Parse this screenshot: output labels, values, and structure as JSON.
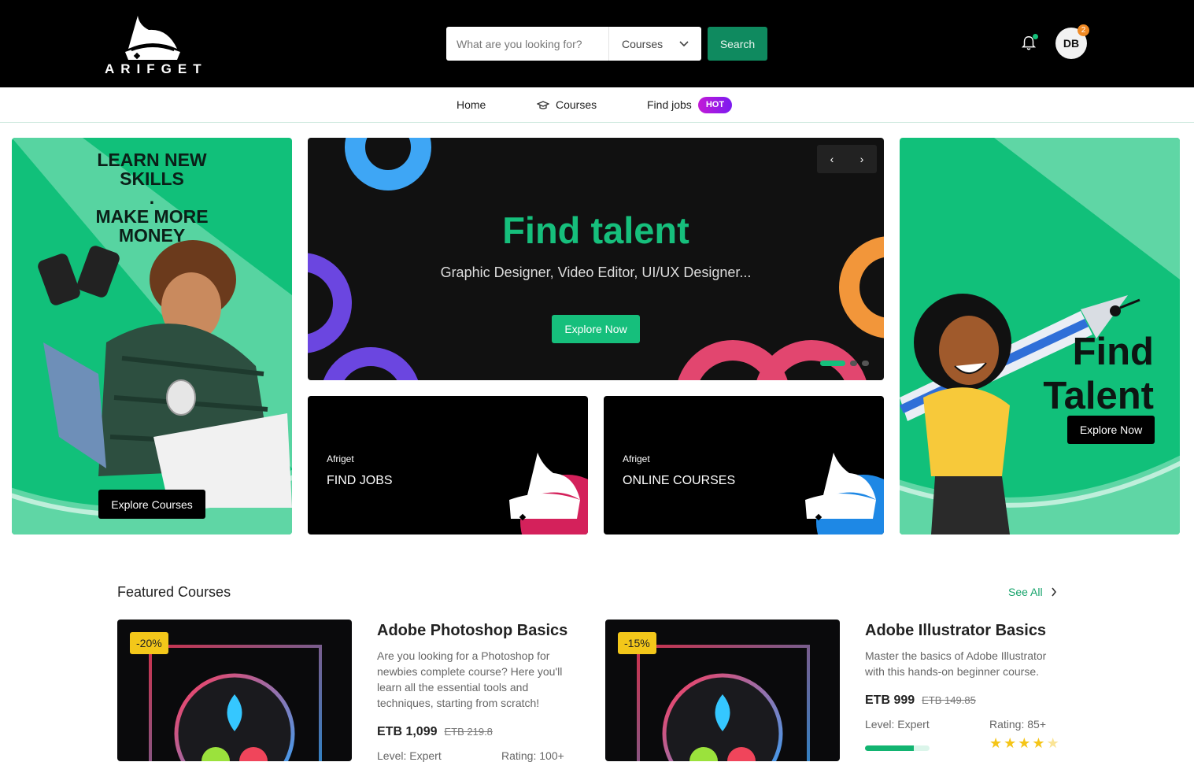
{
  "header": {
    "logo_text": "ARIFGET",
    "search_placeholder": "What are you looking for?",
    "search_category": "Courses",
    "search_button": "Search",
    "avatar_initials": "DB",
    "notification_count": "2",
    "icons": {
      "bell": "bell-icon",
      "chevron": "chevron-down-icon"
    }
  },
  "nav": {
    "items": [
      {
        "label": "Home"
      },
      {
        "label": "Courses",
        "icon": "graduation-cap-icon"
      },
      {
        "label": "Find jobs",
        "badge": "HOT"
      }
    ]
  },
  "promo_left": {
    "title": "LEARN NEW\nSKILLS\n.\nMAKE MORE\nMONEY",
    "button": "Explore Courses"
  },
  "slider": {
    "title": "Find talent",
    "subtitle": "Graphic Designer, Video Editor, UI/UX Designer...",
    "button": "Explore Now",
    "prev": "‹",
    "next": "›",
    "slides": 3,
    "active_slide": 1
  },
  "mini_cards": [
    {
      "brand": "Afriget",
      "title": "FIND JOBS",
      "accent": "#d4215b"
    },
    {
      "brand": "Afriget",
      "title": "ONLINE COURSES",
      "accent": "#1e88e5"
    }
  ],
  "promo_right": {
    "title": "Find\nTalent",
    "button": "Explore Now"
  },
  "featured": {
    "title": "Featured Courses",
    "see_all": "See All",
    "courses": [
      {
        "discount": "-20%",
        "title": "Adobe Photoshop Basics",
        "description": "Are you looking for a Photoshop for newbies complete course? Here you'll learn all the essential tools and techniques, starting from scratch!",
        "price": "ETB 1,099",
        "old_price": "ETB 219.8",
        "level": "Level: Expert",
        "rating": "Rating: 100+"
      },
      {
        "discount": "-15%",
        "title": "Adobe Illustrator Basics",
        "description": "Master the basics of Adobe Illustrator with this hands-on beginner course.",
        "price": "ETB 999",
        "old_price": "ETB 149.85",
        "level": "Level: Expert",
        "level_progress": 0.75,
        "rating": "Rating: 85+",
        "stars": 4.5
      }
    ]
  },
  "colors": {
    "brand_green": "#11c07a",
    "accent_green": "#16bf7c",
    "search_button": "#0f8a5f",
    "badge_orange": "#f08a24",
    "discount_yellow": "#f3c71a"
  }
}
